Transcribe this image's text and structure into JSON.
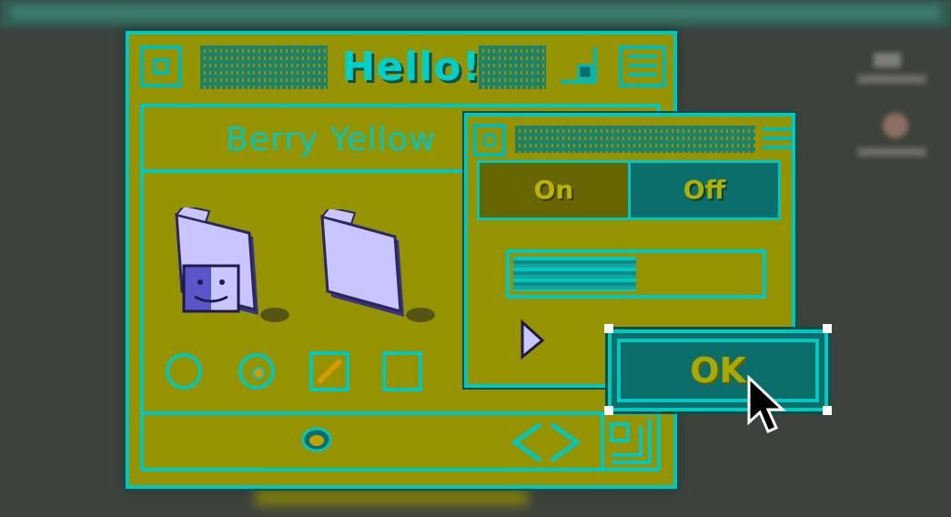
{
  "window": {
    "title": "Hello!",
    "theme_name": "Berry Yellow"
  },
  "panel": {
    "tabs": [
      {
        "label": "On",
        "selected": true
      },
      {
        "label": "Off",
        "selected": false
      }
    ],
    "progress": 0.5,
    "ok_label": "OK"
  },
  "colors": {
    "window_bg": "#959400",
    "accent": "#00c7c0",
    "dark_teal": "#0b6e6a",
    "folder": "#c9c6ff"
  },
  "icons": {
    "finder_folder": "finder-folder-icon",
    "plain_folder": "folder-icon",
    "play": "play-triangle-icon",
    "bullet": "bullet-icon",
    "nav_arrows": "left-right-arrows-icon",
    "resize": "resize-grip-icon"
  }
}
